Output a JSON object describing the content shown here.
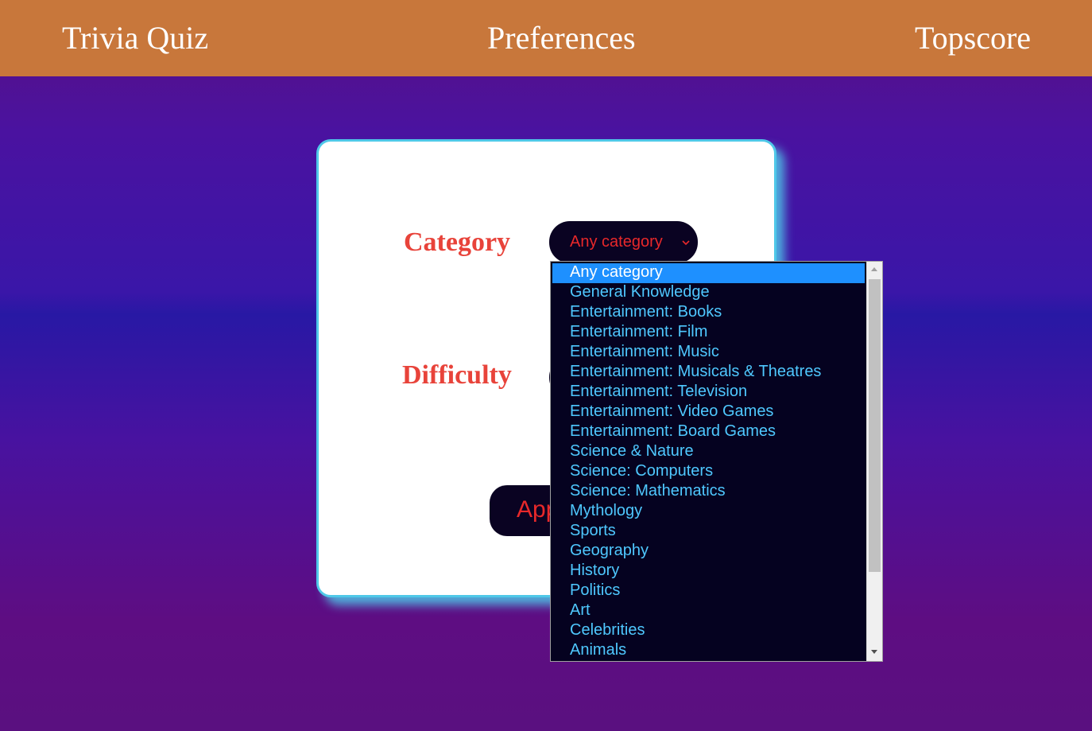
{
  "nav": {
    "brand": "Trivia Quiz",
    "preferences": "Preferences",
    "topscore": "Topscore"
  },
  "form": {
    "category_label": "Category",
    "difficulty_label": "Difficulty",
    "category_value": "Any category",
    "apply_label": "Apply"
  },
  "dropdown": {
    "selected_index": 0,
    "options": [
      "Any category",
      "General Knowledge",
      "Entertainment: Books",
      "Entertainment: Film",
      "Entertainment: Music",
      "Entertainment: Musicals & Theatres",
      "Entertainment: Television",
      "Entertainment: Video Games",
      "Entertainment: Board Games",
      "Science & Nature",
      "Science: Computers",
      "Science: Mathematics",
      "Mythology",
      "Sports",
      "Geography",
      "History",
      "Politics",
      "Art",
      "Celebrities",
      "Animals"
    ]
  },
  "icons": {
    "select_arrow": "chevron-down-icon",
    "scroll_up": "scroll-up-arrow-icon",
    "scroll_down": "scroll-down-arrow-icon"
  },
  "colors": {
    "navbar": "#c8773b",
    "label_red": "#e8433a",
    "option_text": "#4fc8ff",
    "highlight": "#1e90ff",
    "card_border": "#4fc8e8"
  }
}
